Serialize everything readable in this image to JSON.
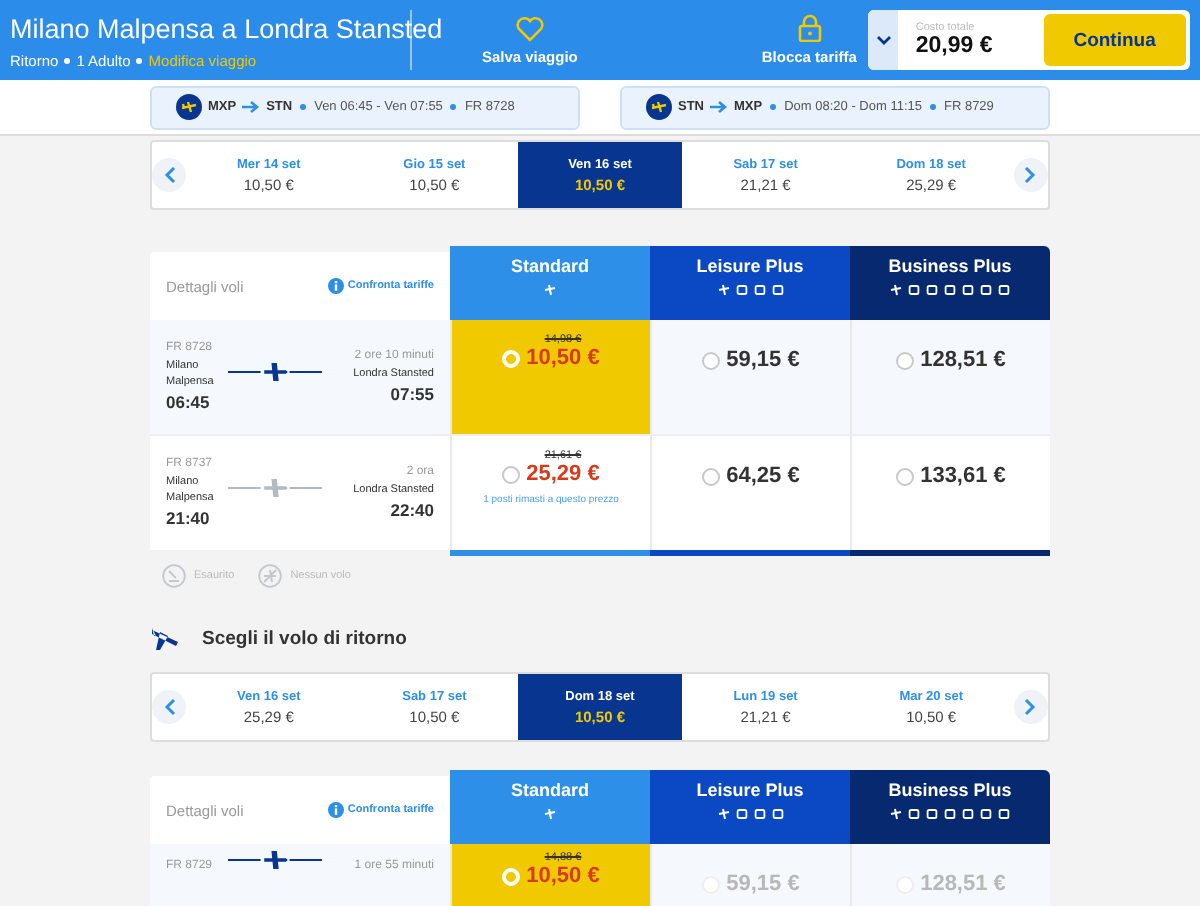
{
  "header": {
    "title": "Milano Malpensa a Londra Stansted",
    "trip_type": "Ritorno",
    "passengers": "1 Adulto",
    "modify_link": "Modifica viaggio",
    "save_label": "Salva viaggio",
    "lock_label": "Blocca tariffa",
    "total_label": "Costo totale",
    "total": "20,99 €",
    "continue_button": "Continua"
  },
  "summary": [
    {
      "from": "MXP",
      "to": "STN",
      "times": "Ven 06:45 - Ven 07:55",
      "flight": "FR 8728"
    },
    {
      "from": "STN",
      "to": "MXP",
      "times": "Dom 08:20 - Dom 11:15",
      "flight": "FR 8729"
    }
  ],
  "outbound": {
    "dates": [
      {
        "day": "Mer 14 set",
        "price": "10,50 €",
        "selected": false
      },
      {
        "day": "Gio 15 set",
        "price": "10,50 €",
        "selected": false
      },
      {
        "day": "Ven 16 set",
        "price": "10,50 €",
        "selected": true
      },
      {
        "day": "Sab 17 set",
        "price": "21,21 €",
        "selected": false
      },
      {
        "day": "Dom 18 set",
        "price": "25,29 €",
        "selected": false
      }
    ],
    "table": {
      "details_label": "Dettagli voli",
      "compare_link": "Confronta tariffe",
      "fares": [
        {
          "name": "Standard",
          "kind": "standard"
        },
        {
          "name": "Leisure Plus",
          "kind": "leisure"
        },
        {
          "name": "Business Plus",
          "kind": "business"
        }
      ],
      "flights": [
        {
          "number": "FR 8728",
          "duration": "2 ore 10 minuti",
          "from": "Milano Malpensa",
          "to": "Londra Stansted",
          "departure": "06:45",
          "arrival": "07:55",
          "selected": true,
          "prices": [
            {
              "old": "14,98 €",
              "price": "10,50 €",
              "selected": true,
              "disabled": false
            },
            {
              "price": "59,15 €",
              "selected": false,
              "disabled": false
            },
            {
              "price": "128,51 €",
              "selected": false,
              "disabled": false
            }
          ]
        },
        {
          "number": "FR 8737",
          "duration": "2 ora",
          "from": "Milano Malpensa",
          "to": "Londra Stansted",
          "departure": "21:40",
          "arrival": "22:40",
          "selected": false,
          "prices": [
            {
              "old": "21,61 €",
              "price": "25,29 €",
              "note": "1 posti rimasti a questo prezzo",
              "selected": false,
              "disabled": false
            },
            {
              "price": "64,25 €",
              "selected": false,
              "disabled": false
            },
            {
              "price": "133,61 €",
              "selected": false,
              "disabled": false
            }
          ]
        }
      ]
    },
    "legend": [
      {
        "kind": "sold_out",
        "label": "Esaurito"
      },
      {
        "kind": "no_flight",
        "label": "Nessun volo"
      }
    ]
  },
  "return": {
    "heading": "Scegli il volo di ritorno",
    "dates": [
      {
        "day": "Ven 16 set",
        "price": "25,29 €",
        "selected": false
      },
      {
        "day": "Sab 17 set",
        "price": "10,50 €",
        "selected": false
      },
      {
        "day": "Dom 18 set",
        "price": "10,50 €",
        "selected": true
      },
      {
        "day": "Lun 19 set",
        "price": "21,21 €",
        "selected": false
      },
      {
        "day": "Mar 20 set",
        "price": "10,50 €",
        "selected": false
      }
    ],
    "table": {
      "details_label": "Dettagli voli",
      "compare_link": "Confronta tariffe",
      "fares": [
        {
          "name": "Standard",
          "kind": "standard"
        },
        {
          "name": "Leisure Plus",
          "kind": "leisure"
        },
        {
          "name": "Business Plus",
          "kind": "business"
        }
      ],
      "flights": [
        {
          "number": "FR 8729",
          "duration": "1 ore 55 minuti",
          "selected": true,
          "prices": [
            {
              "old": "14,88 €",
              "price": "10,50 €",
              "selected": true,
              "disabled": false
            },
            {
              "price": "59,15 €",
              "selected": false,
              "disabled": true
            },
            {
              "price": "128,51 €",
              "selected": false,
              "disabled": true
            }
          ]
        }
      ]
    }
  }
}
